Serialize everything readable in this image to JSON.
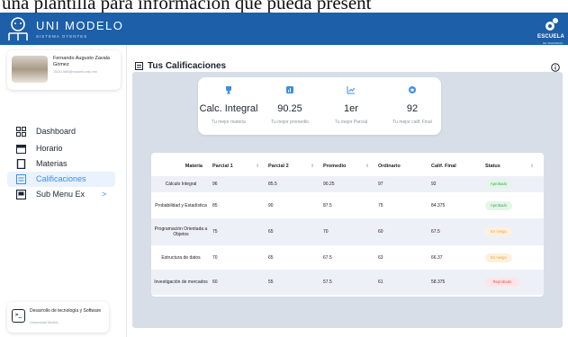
{
  "caption": "una plantilla para información que pueda present",
  "header": {
    "brand": "UNI MODELO",
    "brand_sub": "SISTEMA OYENTES",
    "right_logo": "ESCUELA",
    "right_logo_sub": "DE INGENIERÍA",
    "color": "#1d5fa8"
  },
  "user": {
    "name": "Fernando Augusto Zavala Gómez",
    "email": "15211988@modelo.edu.mx"
  },
  "nav": [
    {
      "label": "Dashboard",
      "icon": "dashboard-icon"
    },
    {
      "label": "Horario",
      "icon": "calendar-icon"
    },
    {
      "label": "Materias",
      "icon": "book-icon"
    },
    {
      "label": "Calificaciones",
      "icon": "grades-icon",
      "active": true
    },
    {
      "label": "Sub Menu Ex",
      "icon": "submenu-icon",
      "chevron": ">"
    }
  ],
  "footer": {
    "title": "Desarrollo de tecnología y Software",
    "subtitle": "Universidad Modelo",
    "icon_text": ">_"
  },
  "page": {
    "title": "Tus Calificaciones"
  },
  "stats": [
    {
      "value": "Calc. Integral",
      "label": "Tu mejor materia",
      "icon": "trophy-icon"
    },
    {
      "value": "90.25",
      "label": "Tu mejor promedio",
      "icon": "chart-icon"
    },
    {
      "value": "1er",
      "label": "Tu mejor Parcial",
      "icon": "trend-icon"
    },
    {
      "value": "92",
      "label": "Tu mejor calif. Final",
      "icon": "star-icon"
    }
  ],
  "table": {
    "columns": [
      "Materia",
      "Parcial 1",
      "Parcial 2",
      "Promedio",
      "Ordinario",
      "Calif. Final",
      "Status"
    ],
    "rows": [
      {
        "materia": "Cálculo Integral",
        "p1": "96",
        "p2": "85.5",
        "prom": "90.25",
        "ord": "97",
        "final": "92",
        "status": "Aprobado",
        "tone": "green"
      },
      {
        "materia": "Probabilidad y Estadística",
        "p1": "85",
        "p2": "90",
        "prom": "87.5",
        "ord": "75",
        "final": "84.375",
        "status": "Aprobado",
        "tone": "green"
      },
      {
        "materia": "Programación Orientada a Objetos",
        "p1": "75",
        "p2": "65",
        "prom": "70",
        "ord": "60",
        "final": "67.5",
        "status": "En riesgo",
        "tone": "orange"
      },
      {
        "materia": "Estructura de datos",
        "p1": "70",
        "p2": "65",
        "prom": "67.5",
        "ord": "63",
        "final": "66.37",
        "status": "En riesgo",
        "tone": "orange"
      },
      {
        "materia": "Investigación de mercados",
        "p1": "60",
        "p2": "55",
        "prom": "57.5",
        "ord": "61",
        "final": "58.375",
        "status": "Reprobado",
        "tone": "red"
      }
    ]
  }
}
